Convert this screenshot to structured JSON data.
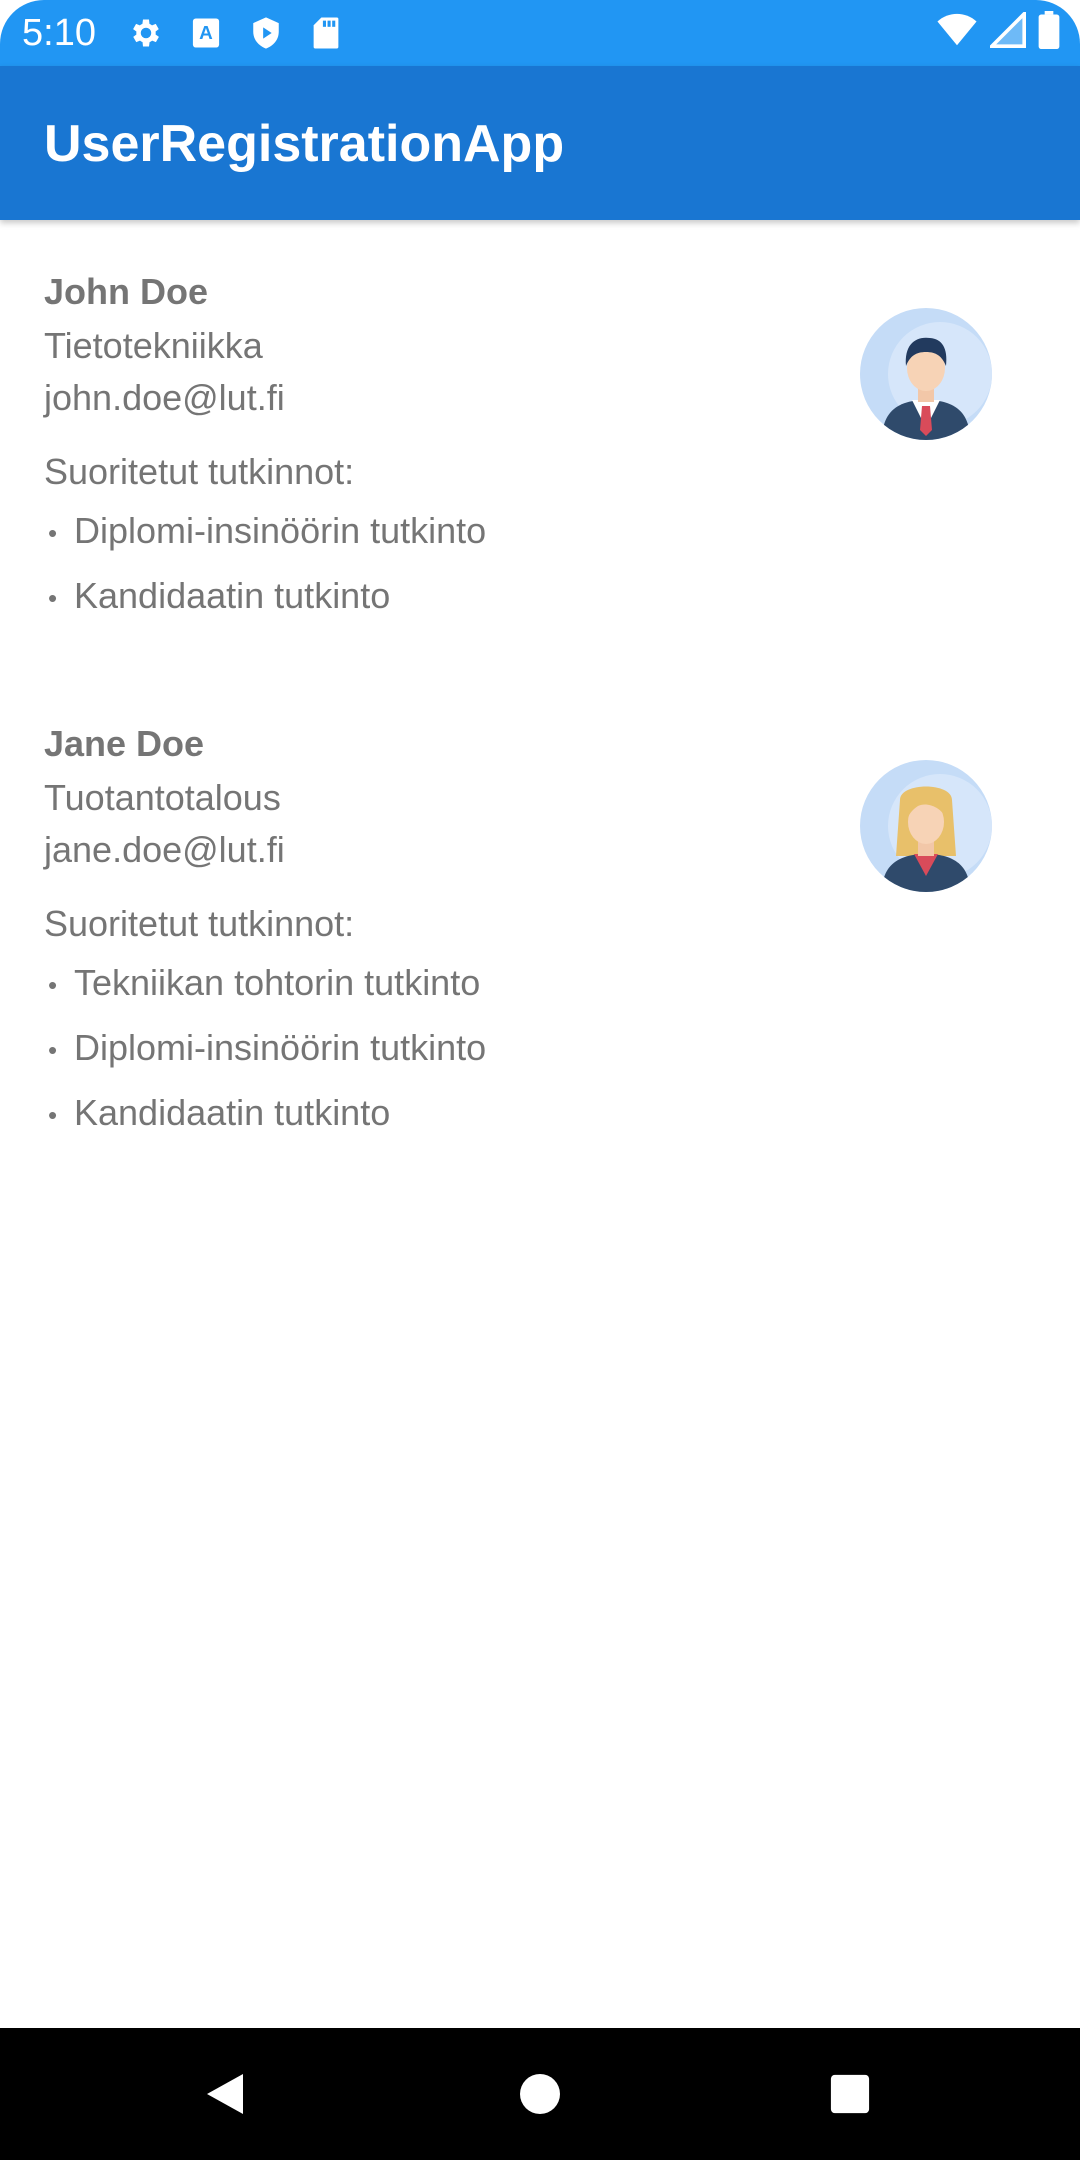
{
  "status_bar": {
    "time": "5:10",
    "left_icons": [
      "gear-icon",
      "text-a-icon",
      "play-protect-icon",
      "sd-card-icon"
    ],
    "right_icons": [
      "wifi-icon",
      "cell-signal-icon",
      "battery-icon"
    ],
    "color": "#2196f3"
  },
  "app_bar": {
    "title": "UserRegistrationApp",
    "color": "#1976d2"
  },
  "users": [
    {
      "name": "John Doe",
      "department": "Tietotekniikka",
      "email": "john.doe@lut.fi",
      "degrees_label": "Suoritetut tutkinnot:",
      "degrees": [
        "Diplomi-insinöörin tutkinto",
        "Kandidaatin tutkinto"
      ],
      "avatar": "male-avatar-icon"
    },
    {
      "name": "Jane Doe",
      "department": "Tuotantotalous",
      "email": "jane.doe@lut.fi",
      "degrees_label": "Suoritetut tutkinnot:",
      "degrees": [
        "Tekniikan tohtorin tutkinto",
        "Diplomi-insinöörin tutkinto",
        "Kandidaatin tutkinto"
      ],
      "avatar": "female-avatar-icon"
    }
  ],
  "bullet": "•",
  "nav_bar": {
    "buttons": [
      "back-icon",
      "home-icon",
      "recents-icon"
    ]
  }
}
